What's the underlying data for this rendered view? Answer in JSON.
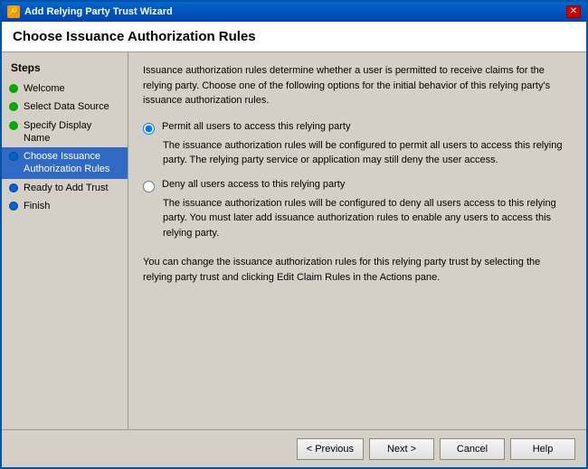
{
  "window": {
    "title": "Add Relying Party Trust Wizard",
    "close_label": "✕"
  },
  "page_header": {
    "title": "Choose Issuance Authorization Rules"
  },
  "description": "Issuance authorization rules determine whether a user is permitted to receive claims for the relying party. Choose one of the following options for the initial behavior of this relying party's issuance authorization rules.",
  "sidebar": {
    "title": "Steps",
    "items": [
      {
        "label": "Welcome",
        "status": "green"
      },
      {
        "label": "Select Data Source",
        "status": "green"
      },
      {
        "label": "Specify Display Name",
        "status": "green"
      },
      {
        "label": "Choose Issuance Authorization Rules",
        "status": "active"
      },
      {
        "label": "Ready to Add Trust",
        "status": "blue"
      },
      {
        "label": "Finish",
        "status": "blue"
      }
    ]
  },
  "radio_options": [
    {
      "id": "permit",
      "label": "Permit all users to access this relying party",
      "description": "The issuance authorization rules will be configured to permit all users to access this relying party. The relying party service or application may still deny the user access.",
      "checked": true
    },
    {
      "id": "deny",
      "label": "Deny all users access to this relying party",
      "description": "The issuance authorization rules will be configured to deny all users access to this relying party. You must later add issuance authorization rules to enable any users to access this relying party.",
      "checked": false
    }
  ],
  "footer_note": "You can change the issuance authorization rules for this relying party trust by selecting the relying party trust and clicking Edit Claim Rules in the Actions pane.",
  "buttons": {
    "previous": "< Previous",
    "next": "Next >",
    "cancel": "Cancel",
    "help": "Help"
  }
}
